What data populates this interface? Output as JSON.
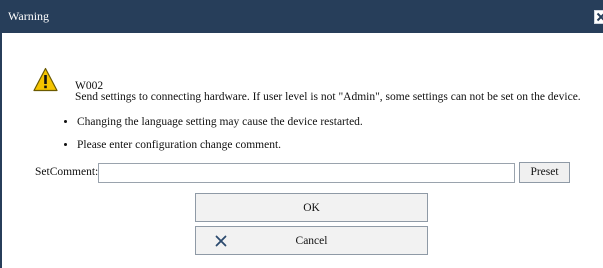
{
  "window": {
    "title": "Warning",
    "close_icon": "close-x-icon"
  },
  "message": {
    "icon": "warning-triangle-icon",
    "code": "W002",
    "text": "Send settings to connecting hardware. If user level is not \"Admin\", some settings can not be set on the device.",
    "bullets": [
      "Changing the language setting may cause the device restarted.",
      "Please enter configuration change comment."
    ]
  },
  "comment": {
    "label": "SetComment:",
    "value": "",
    "preset_label": "Preset"
  },
  "buttons": {
    "ok_label": "OK",
    "cancel_label": "Cancel",
    "cancel_icon": "cancel-x-icon"
  },
  "colors": {
    "titlebar": "#273e5a",
    "warning_fill": "#f5c400",
    "cancel_icon": "#2b4a6e"
  }
}
